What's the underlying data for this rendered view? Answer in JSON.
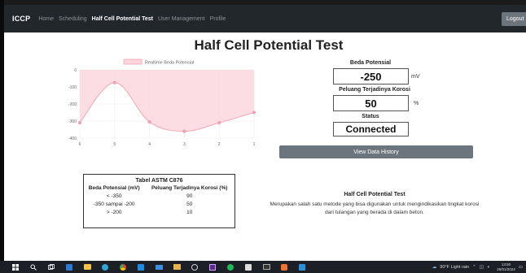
{
  "navbar": {
    "brand": "ICCP",
    "items": [
      "Home",
      "Scheduling",
      "Half Cell Potential Test",
      "User Management",
      "Profile"
    ],
    "active_index": 2,
    "logout_label": "Logout"
  },
  "page_title": "Half Cell Potential Test",
  "chart_data": {
    "type": "line",
    "fill": "area",
    "legend": "Realtime Beda Potensial",
    "legend_position": "top",
    "x": [
      "6",
      "5",
      "4",
      "3",
      "2",
      "1"
    ],
    "y_ticks": [
      "0",
      "-100",
      "-200",
      "-300",
      "-400"
    ],
    "ylim": [
      -400,
      0
    ],
    "series": [
      {
        "name": "Realtime Beda Potensial",
        "values": [
          -310,
          -75,
          -305,
          -360,
          -310,
          -250
        ]
      }
    ],
    "color": "#f3a6b5",
    "fill_color": "#fbd5dd",
    "grid": true
  },
  "readouts": {
    "beda_potensial": {
      "label": "Beda Potensial",
      "value": "-250",
      "unit": "mV"
    },
    "peluang": {
      "label": "Peluang Terjadinya Korosi",
      "value": "50",
      "unit": "%"
    },
    "status": {
      "label": "Status",
      "value": "Connected"
    }
  },
  "history_button": "View Data History",
  "astm_table": {
    "caption": "Tabel ASTM C876",
    "headers": [
      "Beda Potensial (mV)",
      "Peluang Terjadinya Korosi (%)"
    ],
    "rows": [
      [
        "< -350",
        "90"
      ],
      [
        "-350 sampai -200",
        "50"
      ],
      [
        "> -200",
        "10"
      ]
    ]
  },
  "description": {
    "title": "Half Cell Potential Test",
    "text": "Merupakan salah satu metode yang bisa digunakan untuk mengindikasikan tingkat korosi dari tulangan yang berada di dalam beton."
  },
  "taskbar": {
    "weather": "90°F Light rain",
    "time": "13:50",
    "date": "26/01/2024"
  }
}
